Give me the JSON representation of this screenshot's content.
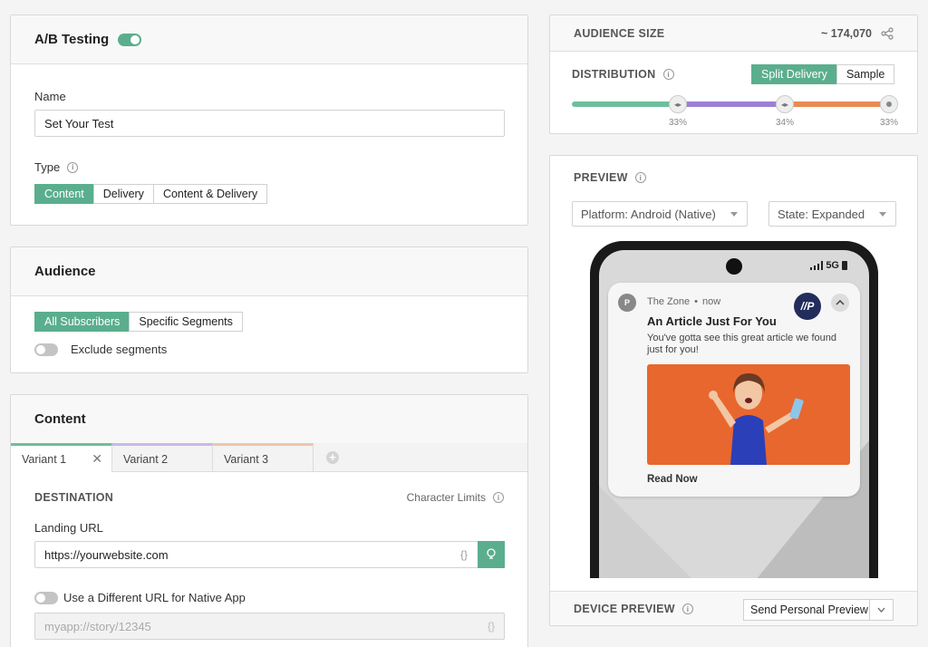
{
  "ab": {
    "title": "A/B Testing",
    "name_label": "Name",
    "name_value": "Set Your Test",
    "type_label": "Type",
    "type_options": [
      "Content",
      "Delivery",
      "Content & Delivery"
    ]
  },
  "audience": {
    "title": "Audience",
    "options": [
      "All Subscribers",
      "Specific Segments"
    ],
    "exclude_label": "Exclude segments"
  },
  "content": {
    "title": "Content",
    "tabs": [
      "Variant 1",
      "Variant 2",
      "Variant 3"
    ],
    "destination_label": "DESTINATION",
    "char_limits_label": "Character Limits",
    "landing_label": "Landing URL",
    "landing_value": "https://yourwebsite.com",
    "braces": "{}",
    "native_label": "Use a Different URL for Native App",
    "native_placeholder": "myapp://story/12345"
  },
  "audience_size": {
    "label": "AUDIENCE SIZE",
    "value": "~ 174,070",
    "distribution_label": "DISTRIBUTION",
    "modes": [
      "Split Delivery",
      "Sample"
    ],
    "splits": [
      "33%",
      "34%",
      "33%"
    ],
    "split_values": [
      33,
      34,
      33
    ]
  },
  "preview": {
    "label": "PREVIEW",
    "platform": "Platform: Android (Native)",
    "state": "State: Expanded",
    "status_network": "5G",
    "app_name": "The Zone",
    "time": "now",
    "notif_title": "An Article Just For You",
    "notif_body": "You've gotta see this great article we found just for you!",
    "action": "Read Now",
    "logo_text": "//P",
    "device_preview_label": "DEVICE PREVIEW",
    "send_label": "Send Personal Preview"
  },
  "colors": {
    "accent": "#5aae8e",
    "variant1": "#6dbf9c",
    "variant2": "#9d7fd6",
    "variant3": "#e98b52",
    "logo_bg": "#232d5c",
    "image_bg": "#e8672e"
  }
}
